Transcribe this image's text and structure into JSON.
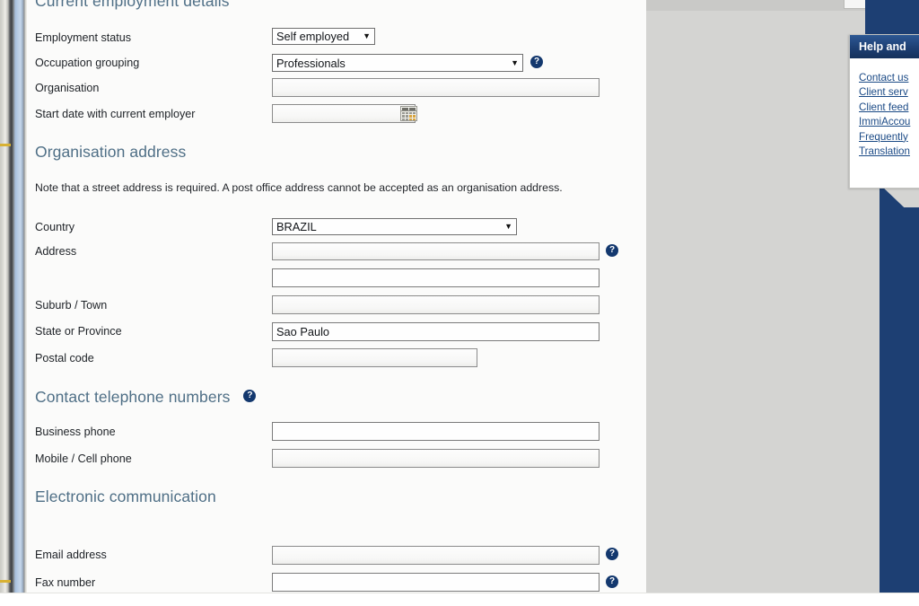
{
  "sections": {
    "employment": {
      "heading": "Current employment details",
      "fields": {
        "employment_status": {
          "label": "Employment status",
          "value": "Self employed"
        },
        "occupation_grouping": {
          "label": "Occupation grouping",
          "value": "Professionals"
        },
        "organisation": {
          "label": "Organisation",
          "value": ""
        },
        "start_date": {
          "label": "Start date with current employer",
          "value": ""
        }
      }
    },
    "org_address": {
      "heading": "Organisation address",
      "note": "Note that a street address is required. A post office address cannot be accepted as an organisation address.",
      "fields": {
        "country": {
          "label": "Country",
          "value": "BRAZIL"
        },
        "address": {
          "label": "Address",
          "value": ""
        },
        "address_line2": {
          "label": "",
          "value": ""
        },
        "suburb": {
          "label": "Suburb / Town",
          "value": ""
        },
        "state": {
          "label": "State or Province",
          "value": "Sao Paulo"
        },
        "postal_code": {
          "label": "Postal code",
          "value": ""
        }
      }
    },
    "telephone": {
      "heading": "Contact telephone numbers",
      "fields": {
        "business_phone": {
          "label": "Business phone",
          "value": ""
        },
        "mobile_phone": {
          "label": "Mobile / Cell phone",
          "value": ""
        }
      }
    },
    "electronic": {
      "heading": "Electronic communication",
      "fields": {
        "email": {
          "label": "Email address",
          "value": ""
        },
        "fax": {
          "label": "Fax number",
          "value": ""
        }
      }
    }
  },
  "help_panel": {
    "title": "Help and",
    "links": [
      "Contact us",
      "Client serv",
      "Client feed",
      "ImmiAccou",
      "Frequently",
      "Translation"
    ]
  },
  "icons": {
    "help_glyph": "?",
    "caret_glyph": "▼"
  },
  "colors": {
    "heading": "#4f6f86",
    "help_bubble": "#13386e",
    "rail_blue": "#1d3f73",
    "link": "#1b4a86",
    "accent_gold": "#d8b133"
  }
}
